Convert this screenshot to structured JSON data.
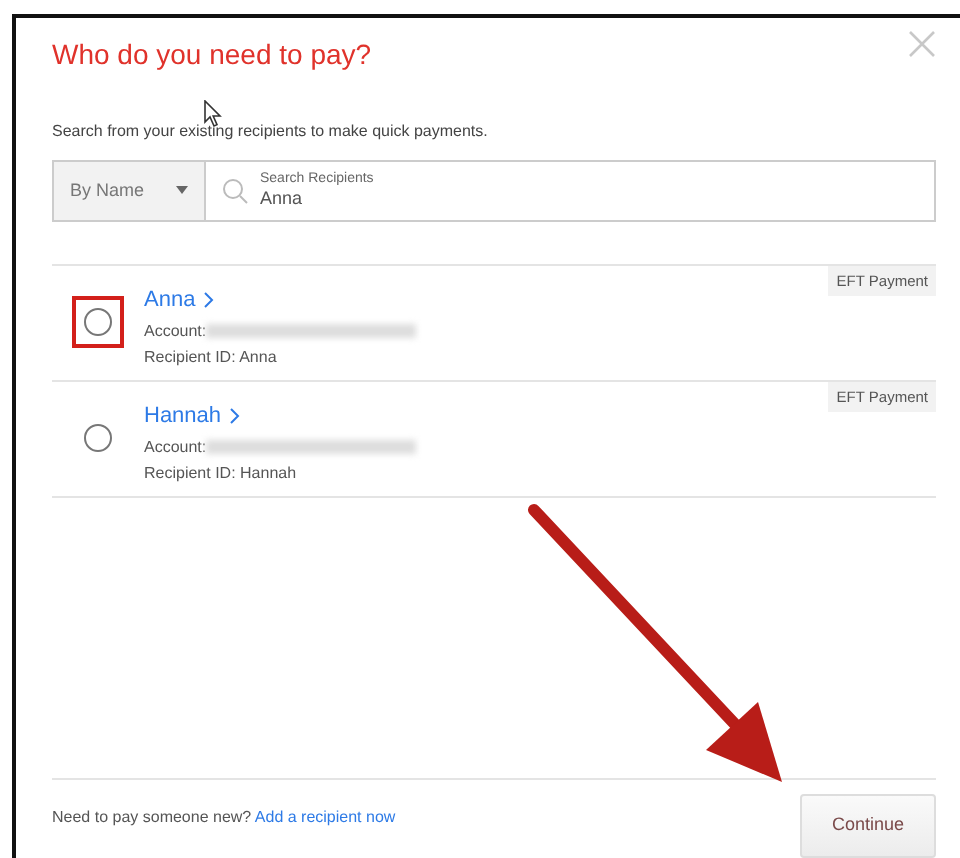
{
  "dialog": {
    "title": "Who do you need to pay?",
    "description": "Search from your existing recipients to make quick payments."
  },
  "search": {
    "filter": "By Name",
    "label": "Search Recipients",
    "value": "Anna"
  },
  "recipients": [
    {
      "name": "Anna",
      "account_label": "Account:",
      "recipient_id": "Recipient ID: Anna",
      "tag": "EFT Payment",
      "selected": false,
      "highlighted": true
    },
    {
      "name": "Hannah",
      "account_label": "Account:",
      "recipient_id": "Recipient ID: Hannah",
      "tag": "EFT Payment",
      "selected": false,
      "highlighted": false
    }
  ],
  "footer": {
    "text": "Need to pay someone new?",
    "link": "Add a recipient now",
    "button": "Continue"
  }
}
